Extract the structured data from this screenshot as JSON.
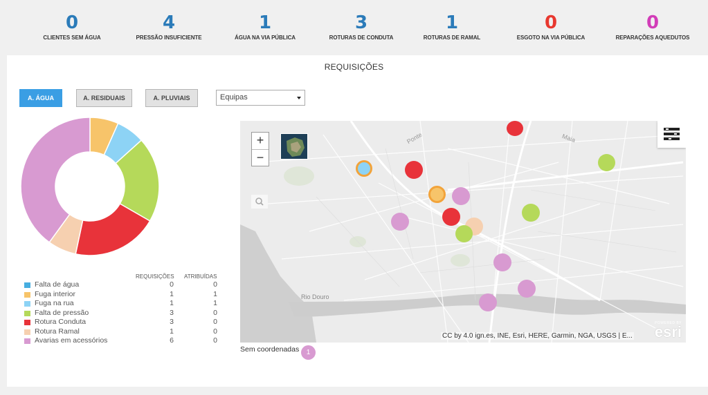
{
  "kpis": [
    {
      "value": "0",
      "label": "CLIENTES SEM ÁGUA",
      "color": "#2b7bb9"
    },
    {
      "value": "4",
      "label": "PRESSÃO INSUFICIENTE",
      "color": "#2b7bb9"
    },
    {
      "value": "1",
      "label": "ÁGUA NA VIA PÚBLICA",
      "color": "#2b7bb9"
    },
    {
      "value": "3",
      "label": "ROTURAS DE CONDUTA",
      "color": "#2b7bb9"
    },
    {
      "value": "1",
      "label": "ROTURAS DE RAMAL",
      "color": "#2b7bb9"
    },
    {
      "value": "0",
      "label": "ESGOTO NA VIA PÚBLICA",
      "color": "#e8382f"
    },
    {
      "value": "0",
      "label": "REPARAÇÕES AQUEDUTOS",
      "color": "#d23db8"
    }
  ],
  "panel": {
    "title": "REQUISIÇÕES",
    "tabs": [
      {
        "label": "A. ÁGUA",
        "active": true
      },
      {
        "label": "A. RESIDUAIS",
        "active": false
      },
      {
        "label": "A. PLUVIAIS",
        "active": false
      }
    ],
    "select": {
      "value": "Equipas"
    }
  },
  "legend": {
    "col1": "REQUISIÇÕES",
    "col2": "ATRIBUÍDAS",
    "rows": [
      {
        "name": "Falta de água",
        "req": "0",
        "atr": "0",
        "color": "#47aee0"
      },
      {
        "name": "Fuga interior",
        "req": "1",
        "atr": "1",
        "color": "#f7c46a"
      },
      {
        "name": "Fuga na rua",
        "req": "1",
        "atr": "1",
        "color": "#8dd3f5"
      },
      {
        "name": "Falta de pressão",
        "req": "3",
        "atr": "0",
        "color": "#b5d95a"
      },
      {
        "name": "Rotura Conduta",
        "req": "3",
        "atr": "0",
        "color": "#e8333a"
      },
      {
        "name": "Rotura Ramal",
        "req": "1",
        "atr": "0",
        "color": "#f6d0b0"
      },
      {
        "name": "Avarias em acessórios",
        "req": "6",
        "atr": "0",
        "color": "#d89ad1"
      }
    ]
  },
  "donut_values": [
    {
      "label": "Fuga interior",
      "value": 1,
      "color": "#f7c46a"
    },
    {
      "label": "Fuga na rua",
      "value": 1,
      "color": "#8dd3f5"
    },
    {
      "label": "Falta de pressão",
      "value": 3,
      "color": "#b5d95a"
    },
    {
      "label": "Rotura Conduta",
      "value": 3,
      "color": "#e8333a"
    },
    {
      "label": "Rotura Ramal",
      "value": 1,
      "color": "#f6d0b0"
    },
    {
      "label": "Avarias em acessórios",
      "value": 6,
      "color": "#d89ad1"
    }
  ],
  "map": {
    "zoom_in": "+",
    "zoom_out": "−",
    "labels": [
      "Rio Douro",
      "Ponte",
      "Maia"
    ],
    "attribution": "CC by 4.0 ign.es, INE, Esri, HERE, Garmin, NGA, USGS | E...",
    "esri_logo": "esri",
    "esri_powered": "POWERED BY"
  },
  "no_coords": {
    "label": "Sem coordenadas",
    "count": "1"
  }
}
